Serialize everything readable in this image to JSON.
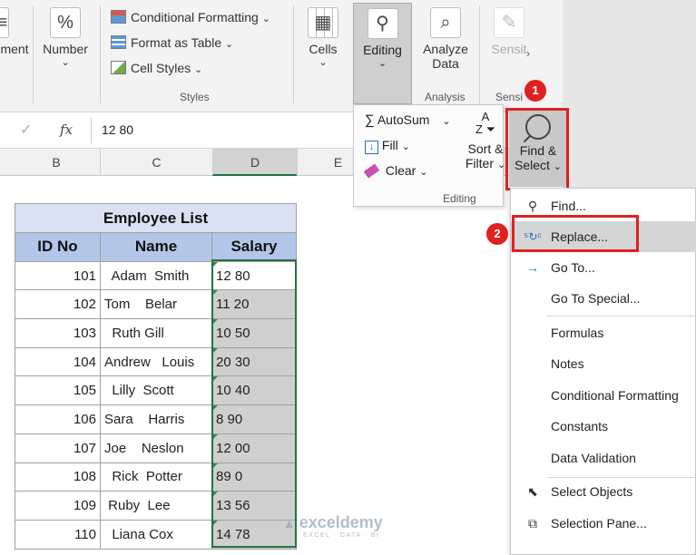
{
  "ribbon": {
    "alignment_label": "ment",
    "number_label": "Number",
    "number_icon": "%",
    "styles": {
      "conditional_formatting": "Conditional Formatting",
      "format_as_table": "Format as Table",
      "cell_styles": "Cell Styles",
      "group_label": "Styles"
    },
    "cells_label": "Cells",
    "editing_label": "Editing",
    "analyze_data_line1": "Analyze",
    "analyze_data_line2": "Data",
    "analysis_group_label": "Analysis",
    "sensitivity_label": "Sensit",
    "sensitivity_group_label": "Sensi"
  },
  "formula_bar": {
    "fx": "fx",
    "value": "12 80"
  },
  "columns": [
    "B",
    "C",
    "D",
    "E"
  ],
  "editing_panel": {
    "autosum": "AutoSum",
    "fill": "Fill",
    "clear": "Clear",
    "sort_filter_line1": "Sort &",
    "sort_filter_line2": "Filter",
    "find_select_line1": "Find &",
    "find_select_line2": "Select",
    "group_label": "Editing"
  },
  "menu": {
    "items": [
      {
        "label": "Find...",
        "icon": "search-icon"
      },
      {
        "label": "Replace...",
        "icon": "replace-icon"
      },
      {
        "label": "Go To...",
        "icon": "arrow-right-icon"
      },
      {
        "label": "Go To Special...",
        "icon": ""
      },
      {
        "label": "Formulas",
        "icon": ""
      },
      {
        "label": "Notes",
        "icon": ""
      },
      {
        "label": "Conditional Formatting",
        "icon": ""
      },
      {
        "label": "Constants",
        "icon": ""
      },
      {
        "label": "Data Validation",
        "icon": ""
      },
      {
        "label": "Select Objects",
        "icon": "cursor-icon"
      },
      {
        "label": "Selection Pane...",
        "icon": "selection-pane-icon"
      }
    ]
  },
  "table": {
    "title": "Employee List",
    "headers": [
      "ID No",
      "Name",
      "Salary"
    ],
    "rows": [
      {
        "id": "101",
        "name": "  Adam  Smith",
        "salary": "12 80"
      },
      {
        "id": "102",
        "name": "Tom    Belar",
        "salary": "11 20"
      },
      {
        "id": "103",
        "name": "  Ruth Gill",
        "salary": "10 50"
      },
      {
        "id": "104",
        "name": "Andrew   Louis",
        "salary": "20 30"
      },
      {
        "id": "105",
        "name": "  Lilly  Scott",
        "salary": "10 40"
      },
      {
        "id": "106",
        "name": "Sara    Harris",
        "salary": "8 90"
      },
      {
        "id": "107",
        "name": "Joe    Neslon",
        "salary": "12 00"
      },
      {
        "id": "108",
        "name": "  Rick  Potter",
        "salary": "89 0"
      },
      {
        "id": "109",
        "name": " Ruby  Lee",
        "salary": "13 56"
      },
      {
        "id": "110",
        "name": "  Liana Cox",
        "salary": "14 78"
      }
    ]
  },
  "badges": [
    "1",
    "2"
  ],
  "watermark": {
    "main": "exceldemy",
    "sub": "EXCEL · DATA · BI"
  },
  "colors": {
    "accent_red": "#e02020",
    "header_blue": "#b4c6e7",
    "title_blue": "#d9e1f2",
    "excel_green": "#217346"
  }
}
